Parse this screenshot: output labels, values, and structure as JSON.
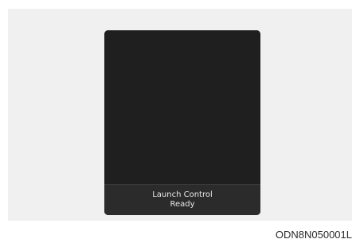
{
  "display": {
    "status_line_1": "Launch Control",
    "status_line_2": "Ready"
  },
  "caption": {
    "code": "ODN8N050001L"
  },
  "colors": {
    "panel_background": "#f0f0f0",
    "display_background": "#1f1f1f",
    "status_bar_background": "#2b2b2b",
    "status_text": "#e8e8e8"
  }
}
